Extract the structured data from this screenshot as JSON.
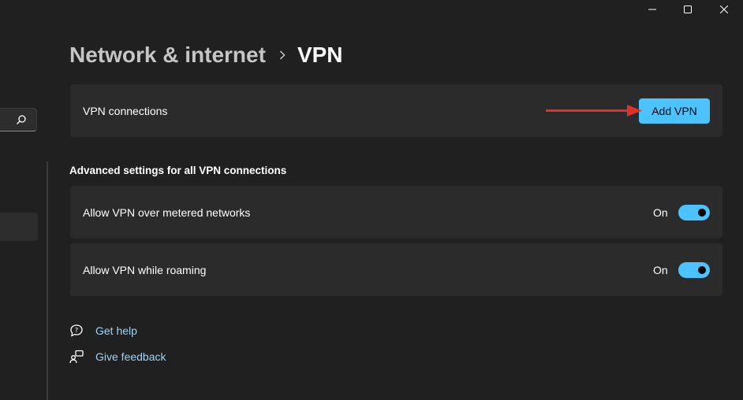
{
  "window": {
    "controls": [
      "minimize-icon",
      "maximize-icon",
      "close-icon"
    ]
  },
  "sidebar": {
    "search_icon": "search-icon"
  },
  "breadcrumb": {
    "parent": "Network & internet",
    "separator_icon": "chevron-right-icon",
    "current": "VPN"
  },
  "vpn_connections": {
    "label": "VPN connections",
    "add_button": "Add VPN"
  },
  "advanced": {
    "title": "Advanced settings for all VPN connections",
    "settings": [
      {
        "label": "Allow VPN over metered networks",
        "state": "On",
        "enabled": true
      },
      {
        "label": "Allow VPN while roaming",
        "state": "On",
        "enabled": true
      }
    ]
  },
  "links": {
    "help": {
      "label": "Get help",
      "icon": "help-chat-icon"
    },
    "feedback": {
      "label": "Give feedback",
      "icon": "feedback-icon"
    }
  },
  "colors": {
    "background": "#202020",
    "card": "#2b2b2b",
    "accent": "#4cc2ff",
    "annotation_arrow": "#e0302a",
    "link": "#9bd4f5"
  }
}
